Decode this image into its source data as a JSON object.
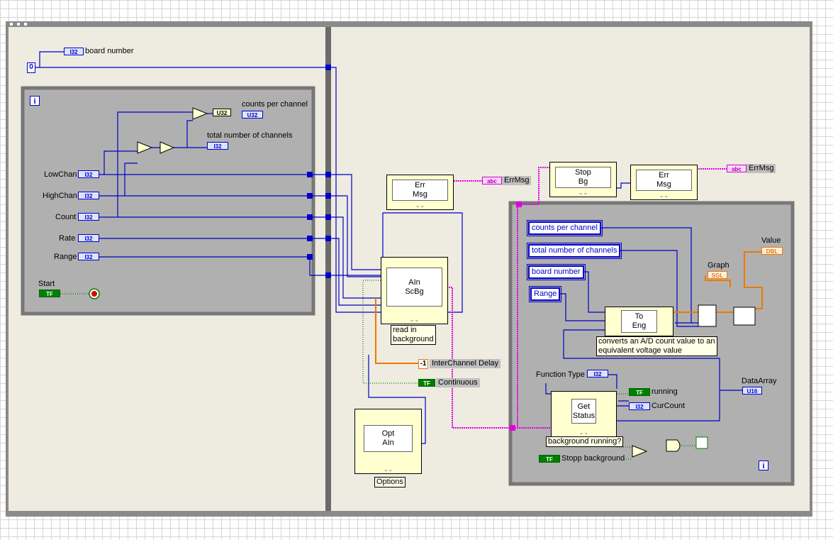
{
  "constants": {
    "board_number_value": "0",
    "interchannel_value": "-1"
  },
  "indicators": {
    "board_number": "board number",
    "counts_per_channel": "counts per channel",
    "total_channels": "total number of channels",
    "u32_type": "U32"
  },
  "loop1": {
    "info_icon": "i",
    "controls": [
      "LowChan",
      "HighChan",
      "Count",
      "Rate",
      "Range"
    ],
    "start_label": "Start"
  },
  "type_tags": {
    "i32": "I32",
    "tf": "TF",
    "str": "abc",
    "sgl": "SGL",
    "dbl": "DBL",
    "u16": "U16"
  },
  "nodes": {
    "err_msg_1": "Err\nMsg",
    "ain_scbg": "AIn\nScBg",
    "opt_ain": "Opt\nAIn",
    "stop_bg": "Stop\nBg",
    "err_msg_2": "Err\nMsg",
    "to_eng": "To\nEng",
    "get_status": "Get\nStatus"
  },
  "captions": {
    "read_in_background": "read in\nbackground",
    "options": "Options",
    "to_eng_desc": "converts an A/D count value to an\nequivalent voltage value",
    "background_running": "background running?"
  },
  "outputs": {
    "errmsg_1": "ErrMsg",
    "errmsg_2": "ErrMsg",
    "interchannel_delay": "InterChannel Delay",
    "continuous": "Continuous"
  },
  "loop2": {
    "local_counts_per_channel": "counts per channel",
    "local_total_channels": "total number of channels",
    "local_board_number": "board number",
    "local_range": "Range",
    "graph": "Graph",
    "value": "Value",
    "data_array": "DataArray",
    "function_type": "Function Type",
    "running": "running",
    "cur_count": "CurCount",
    "stopp_background": "Stopp background",
    "info_icon": "i"
  }
}
